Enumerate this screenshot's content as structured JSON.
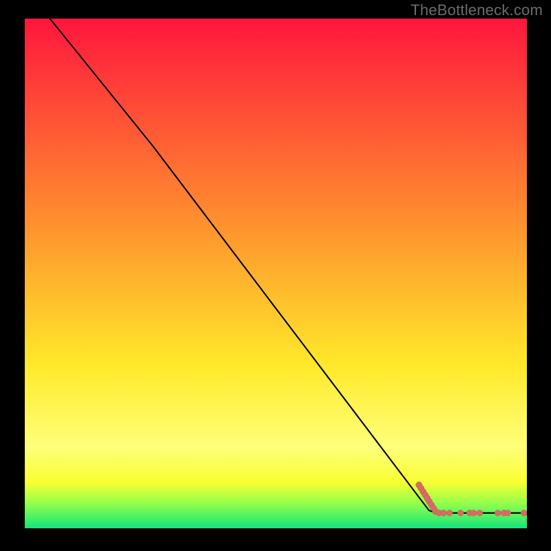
{
  "watermark": "TheBottleneck.com",
  "colors": {
    "background": "#000000",
    "watermark_text": "#6b6b6b",
    "gradient_top": "#ff163d",
    "gradient_mid1": "#ff8a2f",
    "gradient_mid2": "#ffe92a",
    "gradient_low_yellow": "#ffff7a",
    "gradient_lemon": "#f8ff32",
    "gradient_lime": "#96ff4a",
    "gradient_green": "#12e57a",
    "curve": "#000000",
    "marker_fill": "#d46d63",
    "marker_stroke": "#c95a50"
  },
  "chart_data": {
    "type": "line",
    "title": "",
    "xlabel": "",
    "ylabel": "",
    "xlim": [
      0,
      100
    ],
    "ylim": [
      0,
      100
    ],
    "series": [
      {
        "name": "curve",
        "x": [
          5,
          25.5,
          80.5,
          82,
          100
        ],
        "y": [
          100,
          75.0,
          3.5,
          3.0,
          3.0
        ]
      }
    ],
    "marker_segments": [
      {
        "name": "diagonal-end",
        "start": {
          "x": 78.5,
          "y": 8.5
        },
        "end": {
          "x": 81.8,
          "y": 3.3
        },
        "count": 9
      }
    ],
    "marker_points": [
      {
        "x": 82.5,
        "y": 3.0
      },
      {
        "x": 83.4,
        "y": 3.0
      },
      {
        "x": 84.6,
        "y": 3.0
      },
      {
        "x": 86.8,
        "y": 3.0
      },
      {
        "x": 88.6,
        "y": 3.0
      },
      {
        "x": 89.4,
        "y": 3.0
      },
      {
        "x": 90.6,
        "y": 3.0
      },
      {
        "x": 94.2,
        "y": 3.0
      },
      {
        "x": 95.4,
        "y": 3.0
      },
      {
        "x": 96.2,
        "y": 3.0
      },
      {
        "x": 99.4,
        "y": 3.0
      }
    ]
  }
}
